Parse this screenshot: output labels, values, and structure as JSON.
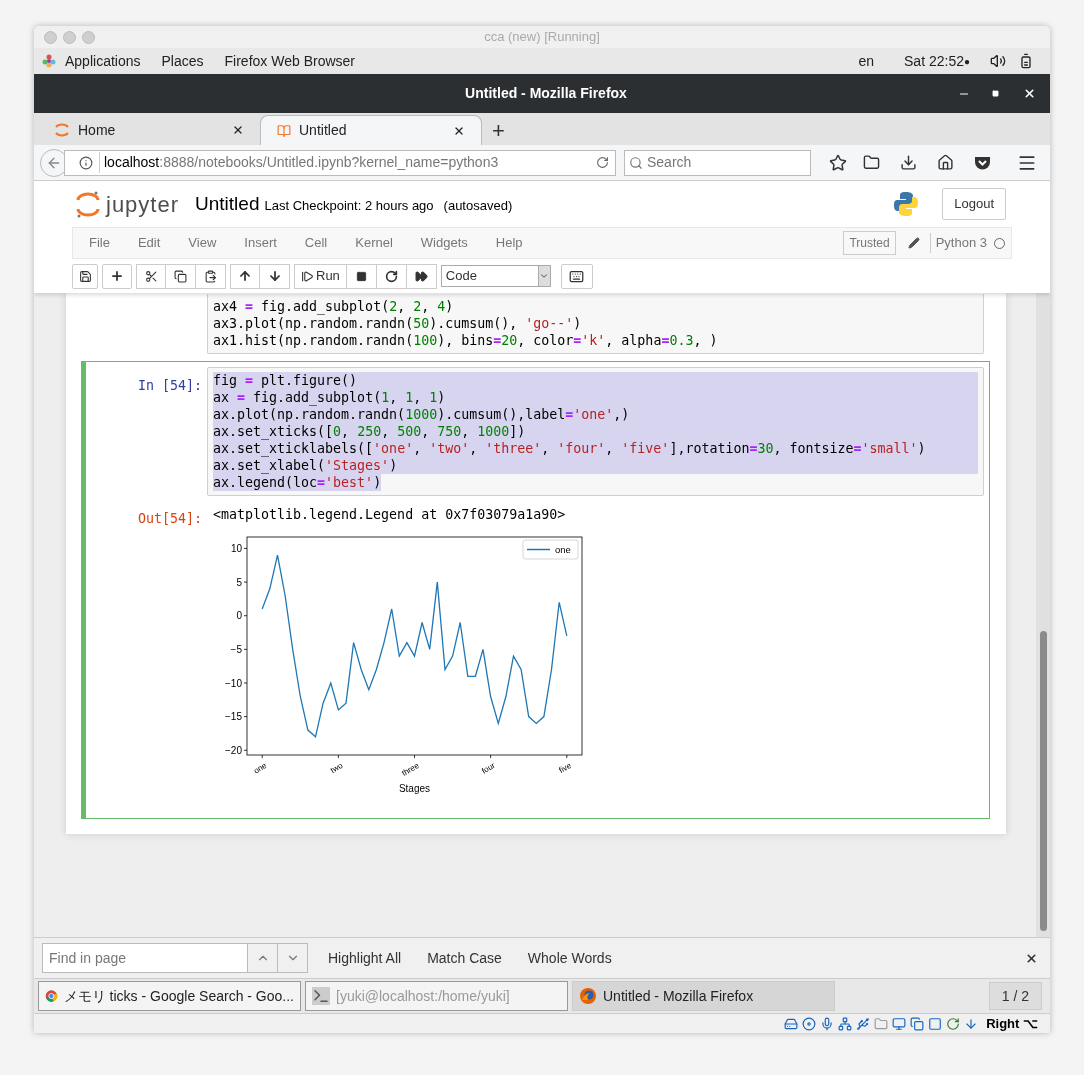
{
  "vm_title": "cca (new) [Running]",
  "top_bar": {
    "menus": [
      "Applications",
      "Places",
      "Firefox Web Browser"
    ],
    "language": "en",
    "clock": "Sat 22:52",
    "indicator": "●"
  },
  "window": {
    "title": "Untitled - Mozilla Firefox"
  },
  "tabs": [
    {
      "label": "Home",
      "selected": false,
      "kind": "jupyter"
    },
    {
      "label": "Untitled",
      "selected": true,
      "kind": "notebook"
    }
  ],
  "new_tab": "+",
  "address": {
    "host": "localhost",
    "rest": ":8888/notebooks/Untitled.ipynb?kernel_name=python3"
  },
  "search": {
    "placeholder": "Search"
  },
  "notebook": {
    "brand": "jupyter",
    "name": "Untitled",
    "checkpoint": "Last Checkpoint: 2 hours ago",
    "autosave": "(autosaved)",
    "logout": "Logout",
    "menu": [
      "File",
      "Edit",
      "View",
      "Insert",
      "Cell",
      "Kernel",
      "Widgets",
      "Help"
    ],
    "trusted": "Trusted",
    "kernel": "Python 3",
    "run": "Run",
    "cell_type": "Code"
  },
  "cells": [
    {
      "selected": false,
      "lines": [
        {
          "selected": false,
          "tokens": [
            {
              "kind": "plain",
              "text": "ax4 "
            },
            {
              "kind": "op",
              "text": "="
            },
            {
              "kind": "plain",
              "text": " fig.add_subplot("
            },
            {
              "kind": "number",
              "text": "2"
            },
            {
              "kind": "plain",
              "text": ", "
            },
            {
              "kind": "number",
              "text": "2"
            },
            {
              "kind": "plain",
              "text": ", "
            },
            {
              "kind": "number",
              "text": "4"
            },
            {
              "kind": "plain",
              "text": ")"
            }
          ]
        },
        {
          "selected": false,
          "tokens": [
            {
              "kind": "plain",
              "text": "ax3.plot(np.random.randn("
            },
            {
              "kind": "number",
              "text": "50"
            },
            {
              "kind": "plain",
              "text": ").cumsum(), "
            },
            {
              "kind": "string",
              "text": "'go--'"
            },
            {
              "kind": "plain",
              "text": ")"
            }
          ]
        },
        {
          "selected": false,
          "tokens": [
            {
              "kind": "plain",
              "text": "ax1.hist(np.random.randn("
            },
            {
              "kind": "number",
              "text": "100"
            },
            {
              "kind": "plain",
              "text": "), bins"
            },
            {
              "kind": "op",
              "text": "="
            },
            {
              "kind": "number",
              "text": "20"
            },
            {
              "kind": "plain",
              "text": ", color"
            },
            {
              "kind": "op",
              "text": "="
            },
            {
              "kind": "string",
              "text": "'k'"
            },
            {
              "kind": "plain",
              "text": ", alpha"
            },
            {
              "kind": "op",
              "text": "="
            },
            {
              "kind": "number",
              "text": "0.3"
            },
            {
              "kind": "plain",
              "text": ", )"
            }
          ]
        }
      ]
    },
    {
      "prompt": "In [54]:",
      "selected": true,
      "lines": [
        {
          "selected": true,
          "tokens": [
            {
              "kind": "plain",
              "text": "fig "
            },
            {
              "kind": "op",
              "text": "="
            },
            {
              "kind": "plain",
              "text": " plt.figure()"
            }
          ]
        },
        {
          "selected": true,
          "tokens": [
            {
              "kind": "plain",
              "text": "ax "
            },
            {
              "kind": "op",
              "text": "="
            },
            {
              "kind": "plain",
              "text": " fig.add_subplot("
            },
            {
              "kind": "number",
              "text": "1"
            },
            {
              "kind": "plain",
              "text": ", "
            },
            {
              "kind": "number",
              "text": "1"
            },
            {
              "kind": "plain",
              "text": ", "
            },
            {
              "kind": "number",
              "text": "1"
            },
            {
              "kind": "plain",
              "text": ")"
            }
          ]
        },
        {
          "selected": true,
          "tokens": [
            {
              "kind": "plain",
              "text": "ax.plot(np.random.randn("
            },
            {
              "kind": "number",
              "text": "1000"
            },
            {
              "kind": "plain",
              "text": ").cumsum(),label"
            },
            {
              "kind": "op",
              "text": "="
            },
            {
              "kind": "string",
              "text": "'one'"
            },
            {
              "kind": "plain",
              "text": ",)"
            }
          ]
        },
        {
          "selected": true,
          "tokens": [
            {
              "kind": "plain",
              "text": "ax.set_xticks(["
            },
            {
              "kind": "number",
              "text": "0"
            },
            {
              "kind": "plain",
              "text": ", "
            },
            {
              "kind": "number",
              "text": "250"
            },
            {
              "kind": "plain",
              "text": ", "
            },
            {
              "kind": "number",
              "text": "500"
            },
            {
              "kind": "plain",
              "text": ", "
            },
            {
              "kind": "number",
              "text": "750"
            },
            {
              "kind": "plain",
              "text": ", "
            },
            {
              "kind": "number",
              "text": "1000"
            },
            {
              "kind": "plain",
              "text": "])"
            }
          ]
        },
        {
          "selected": true,
          "tokens": [
            {
              "kind": "plain",
              "text": "ax.set_xticklabels(["
            },
            {
              "kind": "string",
              "text": "'one'"
            },
            {
              "kind": "plain",
              "text": ", "
            },
            {
              "kind": "string",
              "text": "'two'"
            },
            {
              "kind": "plain",
              "text": ", "
            },
            {
              "kind": "string",
              "text": "'three'"
            },
            {
              "kind": "plain",
              "text": ", "
            },
            {
              "kind": "string",
              "text": "'four'"
            },
            {
              "kind": "plain",
              "text": ", "
            },
            {
              "kind": "string",
              "text": "'five'"
            },
            {
              "kind": "plain",
              "text": "],rotation"
            },
            {
              "kind": "op",
              "text": "="
            },
            {
              "kind": "number",
              "text": "30"
            },
            {
              "kind": "plain",
              "text": ", fontsize"
            },
            {
              "kind": "op",
              "text": "="
            },
            {
              "kind": "string",
              "text": "'small'"
            },
            {
              "kind": "plain",
              "text": ")"
            }
          ]
        },
        {
          "selected": true,
          "tokens": [
            {
              "kind": "plain",
              "text": "ax.set_xlabel("
            },
            {
              "kind": "string",
              "text": "'Stages'"
            },
            {
              "kind": "plain",
              "text": ")"
            }
          ]
        },
        {
          "selected": true,
          "tokens": [
            {
              "kind": "plain",
              "text": "ax.legend(loc"
            },
            {
              "kind": "op",
              "text": "="
            },
            {
              "kind": "string",
              "text": "'best'"
            },
            {
              "kind": "plain",
              "text": ")"
            }
          ]
        }
      ],
      "out_prompt": "Out[54]:",
      "output": "<matplotlib.legend.Legend at 0x7f03079a1a90>",
      "chart_data": {
        "type": "line",
        "xlabel": "Stages",
        "categories": [
          "one",
          null,
          null,
          null,
          null,
          null,
          null,
          null,
          null,
          null,
          "two",
          null,
          null,
          null,
          null,
          null,
          null,
          null,
          null,
          null,
          "three",
          null,
          null,
          null,
          null,
          null,
          null,
          null,
          null,
          null,
          "four",
          null,
          null,
          null,
          null,
          null,
          null,
          null,
          null,
          null,
          "five"
        ],
        "series": [
          {
            "name": "one",
            "color": "#1f77b4",
            "values": [
              1,
              4,
              9,
              3,
              -5,
              -12,
              -17,
              -18,
              -13,
              -10,
              -14,
              -13,
              -4,
              -8,
              -11,
              -8,
              -4,
              1,
              -6,
              -4,
              -6,
              -1,
              -5,
              5,
              -8,
              -6,
              -1,
              -9,
              -9,
              -5,
              -12,
              -16,
              -12,
              -6,
              -8,
              -15,
              -16,
              -15,
              -8,
              2,
              -3
            ]
          }
        ],
        "ylim": [
          -20.7,
          11.7
        ],
        "yticks": [
          {
            "value": 10,
            "label": "10"
          },
          {
            "value": 5,
            "label": "5"
          },
          {
            "value": 0,
            "label": "0"
          },
          {
            "value": -5,
            "label": "−5"
          },
          {
            "value": -10,
            "label": "−10"
          },
          {
            "value": -15,
            "label": "−15"
          },
          {
            "value": -20,
            "label": "−20"
          }
        ]
      }
    }
  ],
  "find_bar": {
    "placeholder": "Find in page",
    "options": [
      "Highlight All",
      "Match Case",
      "Whole Words"
    ]
  },
  "taskbar": {
    "tasks": [
      {
        "label": "メモリ  ticks - Google Search - Goo...",
        "selected": false,
        "dimmed": false,
        "kind": "chrome"
      },
      {
        "label": "[yuki@localhost:/home/yuki]",
        "selected": false,
        "dimmed": true,
        "kind": "terminal"
      },
      {
        "label": "Untitled - Mozilla Firefox",
        "selected": true,
        "dimmed": false,
        "kind": "firefox"
      }
    ],
    "workspace": "1 / 2"
  },
  "status_tray": {
    "host_key": "Right ⌥"
  }
}
